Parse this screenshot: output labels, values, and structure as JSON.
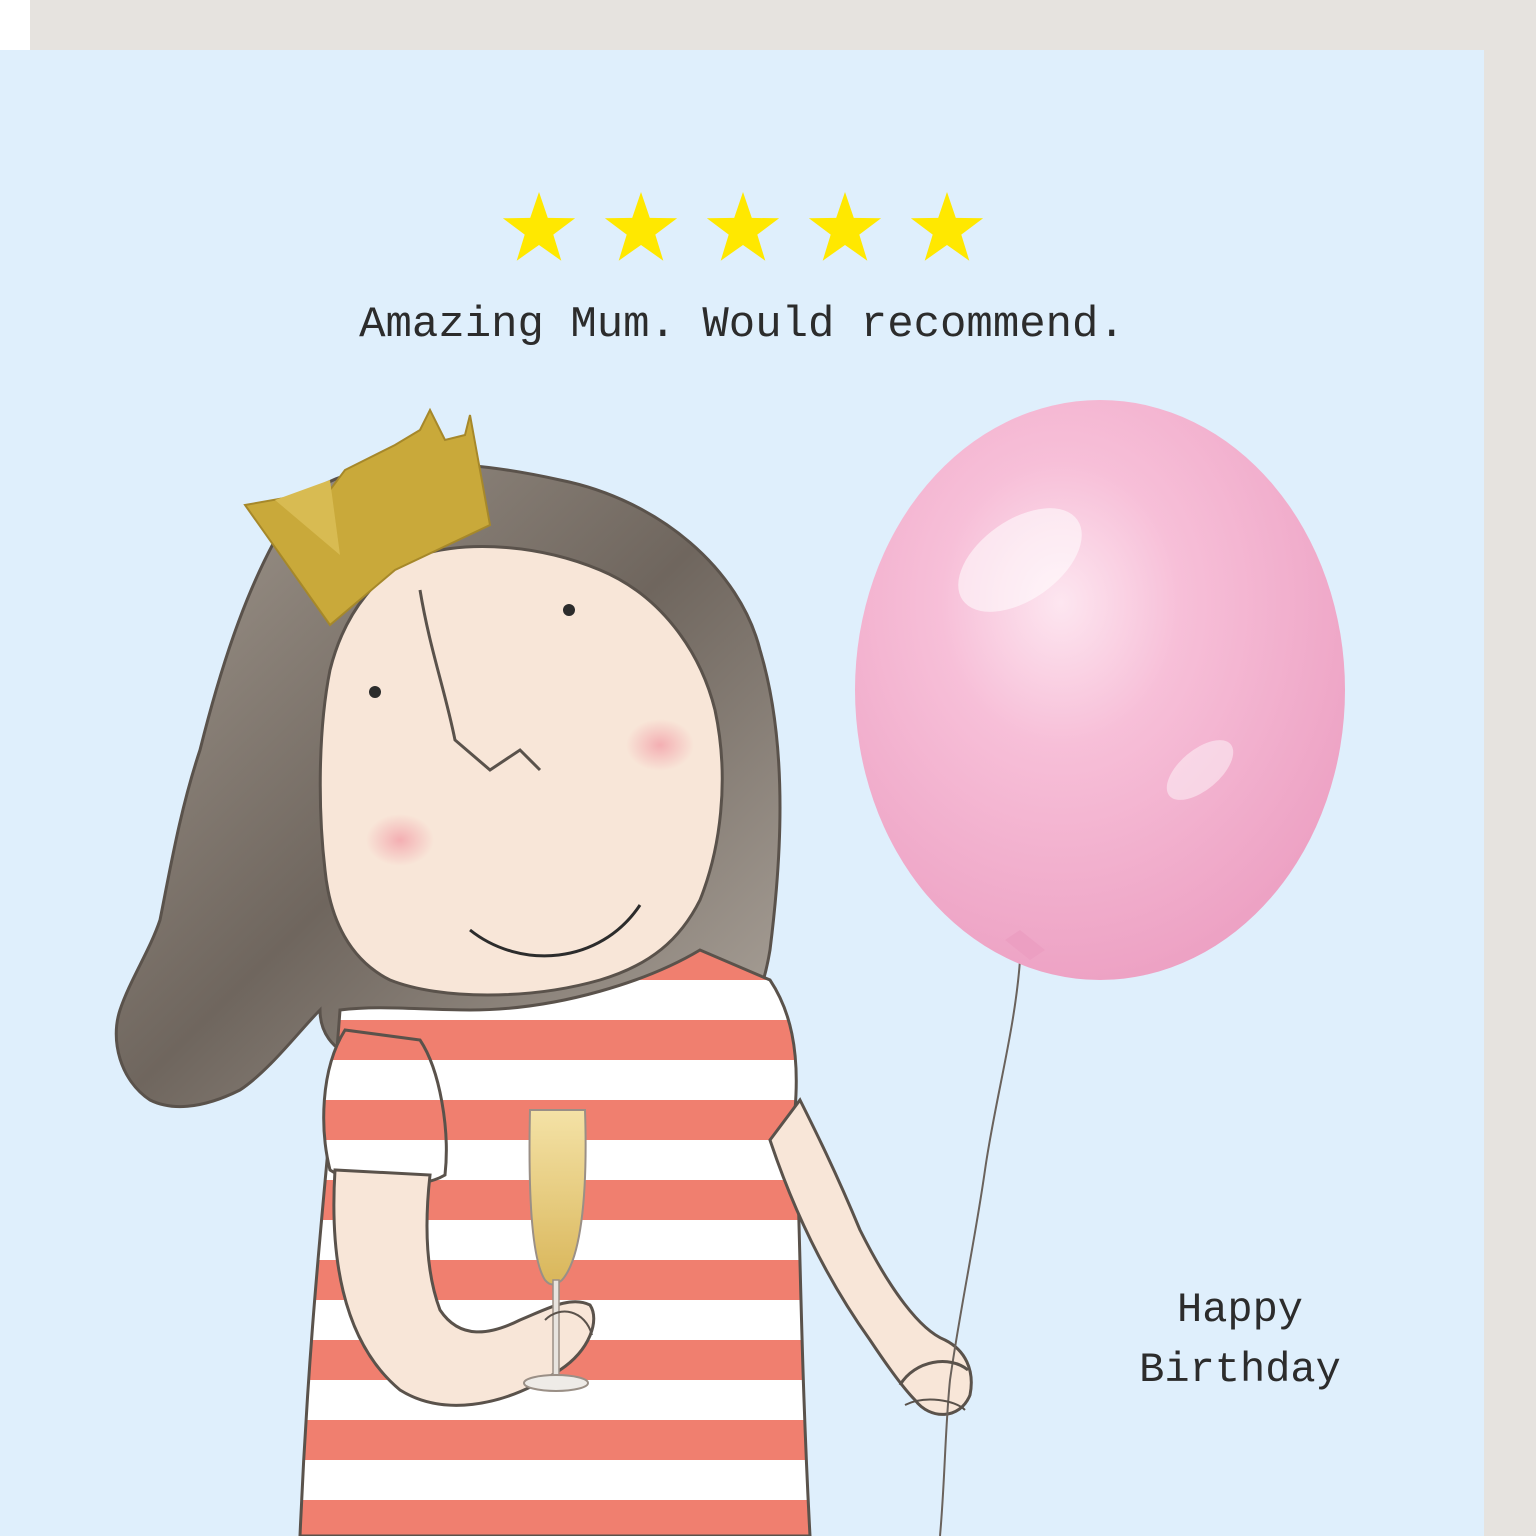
{
  "card": {
    "rating": {
      "stars": 5,
      "max": 5,
      "color": "#ffe800"
    },
    "tagline": "Amazing Mum.  Would recommend.",
    "greeting": {
      "line1": "Happy",
      "line2": "Birthday"
    },
    "colors": {
      "background": "#dfeffc",
      "envelope": "#e6e3df",
      "balloon": "#f5b8d4",
      "stripe_red": "#f07f6f",
      "stripe_white": "#ffffff",
      "skin": "#f8e6d8",
      "crown": "#c9a93a",
      "hair": "#8d8378"
    }
  }
}
